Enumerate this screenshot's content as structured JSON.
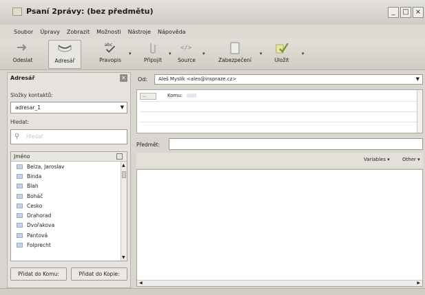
{
  "window": {
    "title": "Psaní 2právy: (bez předmětu)",
    "buttons": [
      "_",
      "□",
      "×"
    ]
  },
  "menu": [
    "Soubor",
    "Úpravy",
    "Zobrazit",
    "Možnosti",
    "Nástroje",
    "Nápověda"
  ],
  "toolbar": {
    "send": "Odeslat",
    "address": "Adresář",
    "spell": "Pravopis",
    "attach": "Připojit",
    "source": "Source",
    "security": "Zabezpečení",
    "save": "Uložit",
    "dropdown_arrow": "▾"
  },
  "sidebar": {
    "title": "Adresář",
    "close_glyph": "✕",
    "folders_label": "Složky kontaktů:",
    "folder_value": "adresar_1",
    "search_label": "Hledat:",
    "search_placeholder": "Hledat",
    "column_name": "Jméno",
    "contacts": [
      "Belza, Jaroslav",
      "Binda",
      "Blah",
      "Boháč",
      "Cesko",
      "Drahorad",
      "Dvořakova",
      "Pantová",
      "Folprecht"
    ],
    "btn_to": "Přidat do Komu:",
    "btn_cc": "Přidat do Kopie:"
  },
  "compose": {
    "from_label": "Od:",
    "from_value": "Aleš Myslík <ales@inspraze.cz>",
    "to_type": "...",
    "to_label": "Komu:",
    "subject_label": "Předmět:",
    "subject_value": "",
    "variables": "Variables",
    "other": "Other"
  }
}
